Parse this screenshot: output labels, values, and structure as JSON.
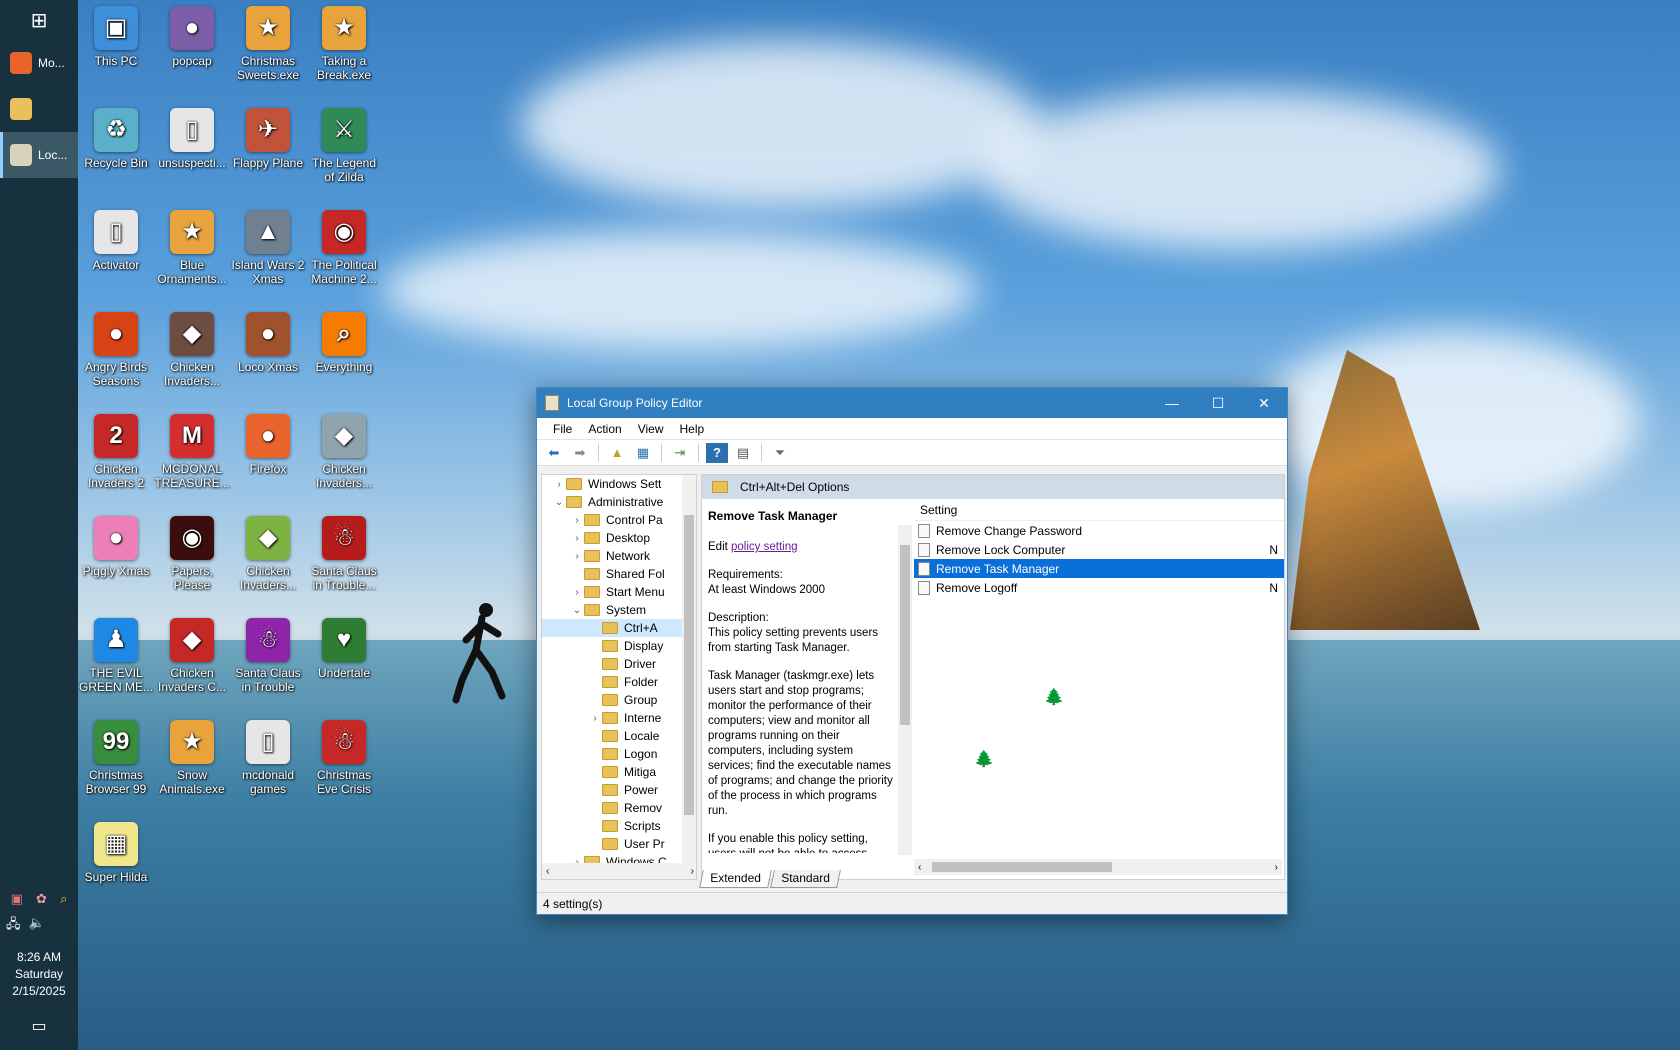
{
  "taskbar": {
    "start_icon": "windows-logo",
    "apps": [
      {
        "label": "Mo...",
        "icon": "firefox",
        "color": "#e8642c"
      },
      {
        "label": "",
        "icon": "file-explorer",
        "color": "#e8c15a"
      },
      {
        "label": "Loc...",
        "icon": "group-policy",
        "color": "#d9d2b8"
      }
    ],
    "time": "8:26 AM",
    "day": "Saturday",
    "date": "2/15/2025"
  },
  "desktop_icons": [
    {
      "label": "This PC",
      "color": "#3c8fd8",
      "glyph": "▣"
    },
    {
      "label": "popcap",
      "color": "#7b5ea7",
      "glyph": "●"
    },
    {
      "label": "Christmas Sweets.exe",
      "color": "#e8a33c",
      "glyph": "★"
    },
    {
      "label": "Taking a Break.exe",
      "color": "#e8a33c",
      "glyph": "★"
    },
    {
      "label": "Recycle Bin",
      "color": "#5ab0c8",
      "glyph": "♻"
    },
    {
      "label": "unsuspecti...",
      "color": "#e6e6e6",
      "glyph": "▯"
    },
    {
      "label": "Flappy Plane",
      "color": "#c0533a",
      "glyph": "✈"
    },
    {
      "label": "The Legend of Zilda",
      "color": "#2e8b57",
      "glyph": "⚔"
    },
    {
      "label": "Activator",
      "color": "#e6e6e6",
      "glyph": "▯"
    },
    {
      "label": "Blue Ornaments...",
      "color": "#e8a33c",
      "glyph": "★"
    },
    {
      "label": "Island Wars 2 Xmas",
      "color": "#708090",
      "glyph": "▲"
    },
    {
      "label": "The Political Machine 2...",
      "color": "#c62828",
      "glyph": "◉"
    },
    {
      "label": "Angry Birds Seasons",
      "color": "#d84315",
      "glyph": "●"
    },
    {
      "label": "Chicken Invaders...",
      "color": "#6d4c41",
      "glyph": "◆"
    },
    {
      "label": "Loco Xmas",
      "color": "#a0522d",
      "glyph": "●"
    },
    {
      "label": "Everything",
      "color": "#f57c00",
      "glyph": "⌕"
    },
    {
      "label": "Chicken Invaders 2",
      "color": "#c62828",
      "glyph": "2"
    },
    {
      "label": "MCDONAL TREASURE...",
      "color": "#d32f2f",
      "glyph": "M"
    },
    {
      "label": "Firefox",
      "color": "#e8642c",
      "glyph": "●"
    },
    {
      "label": "Chicken Invaders...",
      "color": "#90a4ae",
      "glyph": "◆"
    },
    {
      "label": "Piggly Xmas",
      "color": "#ec7fb8",
      "glyph": "●"
    },
    {
      "label": "Papers, Please",
      "color": "#3b0d0d",
      "glyph": "◉"
    },
    {
      "label": "Chicken Invaders...",
      "color": "#7cb342",
      "glyph": "◆"
    },
    {
      "label": "Santa Claus in Trouble...",
      "color": "#b71c1c",
      "glyph": "☃"
    },
    {
      "label": "THE EVIL GREEN ME...",
      "color": "#1e88e5",
      "glyph": "♟"
    },
    {
      "label": "Chicken Invaders C...",
      "color": "#c62828",
      "glyph": "◆"
    },
    {
      "label": "Santa Claus in Trouble",
      "color": "#8e24aa",
      "glyph": "☃"
    },
    {
      "label": "Undertale",
      "color": "#2e7d32",
      "glyph": "♥"
    },
    {
      "label": "Christmas Browser 99",
      "color": "#388e3c",
      "glyph": "99"
    },
    {
      "label": "Snow Animals.exe",
      "color": "#e8a33c",
      "glyph": "★"
    },
    {
      "label": "mcdonald games",
      "color": "#e6e6e6",
      "glyph": "▯"
    },
    {
      "label": "Christmas Eve Crisis",
      "color": "#c62828",
      "glyph": "☃"
    },
    {
      "label": "Super Hilda",
      "color": "#f0e68c",
      "glyph": "▦"
    }
  ],
  "window": {
    "title": "Local Group Policy Editor",
    "menu": [
      "File",
      "Action",
      "View",
      "Help"
    ],
    "tree": [
      {
        "label": "Windows Sett",
        "indent": 1,
        "chev": "›"
      },
      {
        "label": "Administrative",
        "indent": 1,
        "chev": "⌄"
      },
      {
        "label": "Control Pa",
        "indent": 2,
        "chev": "›"
      },
      {
        "label": "Desktop",
        "indent": 2,
        "chev": "›"
      },
      {
        "label": "Network",
        "indent": 2,
        "chev": "›"
      },
      {
        "label": "Shared Fol",
        "indent": 2,
        "chev": ""
      },
      {
        "label": "Start Menu",
        "indent": 2,
        "chev": "›"
      },
      {
        "label": "System",
        "indent": 2,
        "chev": "⌄"
      },
      {
        "label": "Ctrl+A",
        "indent": 3,
        "chev": "",
        "selected": true
      },
      {
        "label": "Display",
        "indent": 3,
        "chev": ""
      },
      {
        "label": "Driver",
        "indent": 3,
        "chev": ""
      },
      {
        "label": "Folder",
        "indent": 3,
        "chev": ""
      },
      {
        "label": "Group",
        "indent": 3,
        "chev": ""
      },
      {
        "label": "Interne",
        "indent": 3,
        "chev": "›"
      },
      {
        "label": "Locale",
        "indent": 3,
        "chev": ""
      },
      {
        "label": "Logon",
        "indent": 3,
        "chev": ""
      },
      {
        "label": "Mitiga",
        "indent": 3,
        "chev": ""
      },
      {
        "label": "Power",
        "indent": 3,
        "chev": ""
      },
      {
        "label": "Remov",
        "indent": 3,
        "chev": ""
      },
      {
        "label": "Scripts",
        "indent": 3,
        "chev": ""
      },
      {
        "label": "User Pr",
        "indent": 3,
        "chev": ""
      },
      {
        "label": "Windows C",
        "indent": 2,
        "chev": "›"
      }
    ],
    "pane_header": "Ctrl+Alt+Del Options",
    "description": {
      "title": "Remove Task Manager",
      "edit_prefix": "Edit ",
      "edit_link": "policy setting",
      "requirements_label": "Requirements:",
      "requirements": "At least Windows 2000",
      "description_label": "Description:",
      "description": "This policy setting prevents users from starting Task Manager.",
      "detail": "Task Manager (taskmgr.exe) lets users start and stop programs; monitor the performance of their computers; view and monitor all programs running on their computers, including system services; find the executable names of programs; and change the priority of the process in which programs run.",
      "more": "If you enable this policy setting, users will not be able to access"
    },
    "list_header": "Setting",
    "settings": [
      {
        "name": "Remove Change Password",
        "state": ""
      },
      {
        "name": "Remove Lock Computer",
        "state": "N"
      },
      {
        "name": "Remove Task Manager",
        "state": "",
        "selected": true
      },
      {
        "name": "Remove Logoff",
        "state": "N"
      }
    ],
    "tabs": [
      "Extended",
      "Standard"
    ],
    "status": "4 setting(s)"
  }
}
